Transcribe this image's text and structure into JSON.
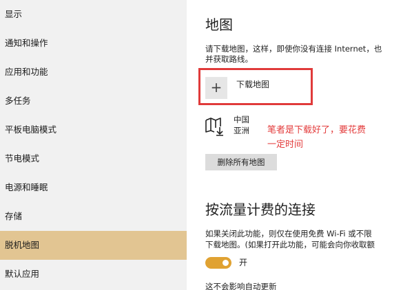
{
  "sidebar": {
    "items": [
      {
        "label": "显示"
      },
      {
        "label": "通知和操作"
      },
      {
        "label": "应用和功能"
      },
      {
        "label": "多任务"
      },
      {
        "label": "平板电脑模式"
      },
      {
        "label": "节电模式"
      },
      {
        "label": "电源和睡眠"
      },
      {
        "label": "存储"
      },
      {
        "label": "脱机地图"
      },
      {
        "label": "默认应用"
      }
    ],
    "selected_index": 8
  },
  "main": {
    "title": "地图",
    "description_line1": "请下载地图，这样，即使你没有连接 Internet，也",
    "description_line2": "并获取路线。",
    "add_icon": "plus-icon",
    "add_label": "下载地图",
    "downloaded_map": {
      "icon": "map-download-icon",
      "region": "中国",
      "subregion": "亚洲"
    },
    "annotation_line1": "笔者是下载好了，要花费",
    "annotation_line2": "一定时间",
    "annotation_color": "#e33b3b",
    "delete_button": "删除所有地图",
    "metered_title": "按流量计费的连接",
    "metered_desc_line1": "如果关闭此功能，则仅在使用免费 Wi-Fi 或不限",
    "metered_desc_line2": "下载地图。(如果打开此功能，可能会向你收取额",
    "toggle_label": "开",
    "toggle_on": true,
    "toggle_color": "#e0a232",
    "footer_text": "这不会影响自动更新"
  }
}
